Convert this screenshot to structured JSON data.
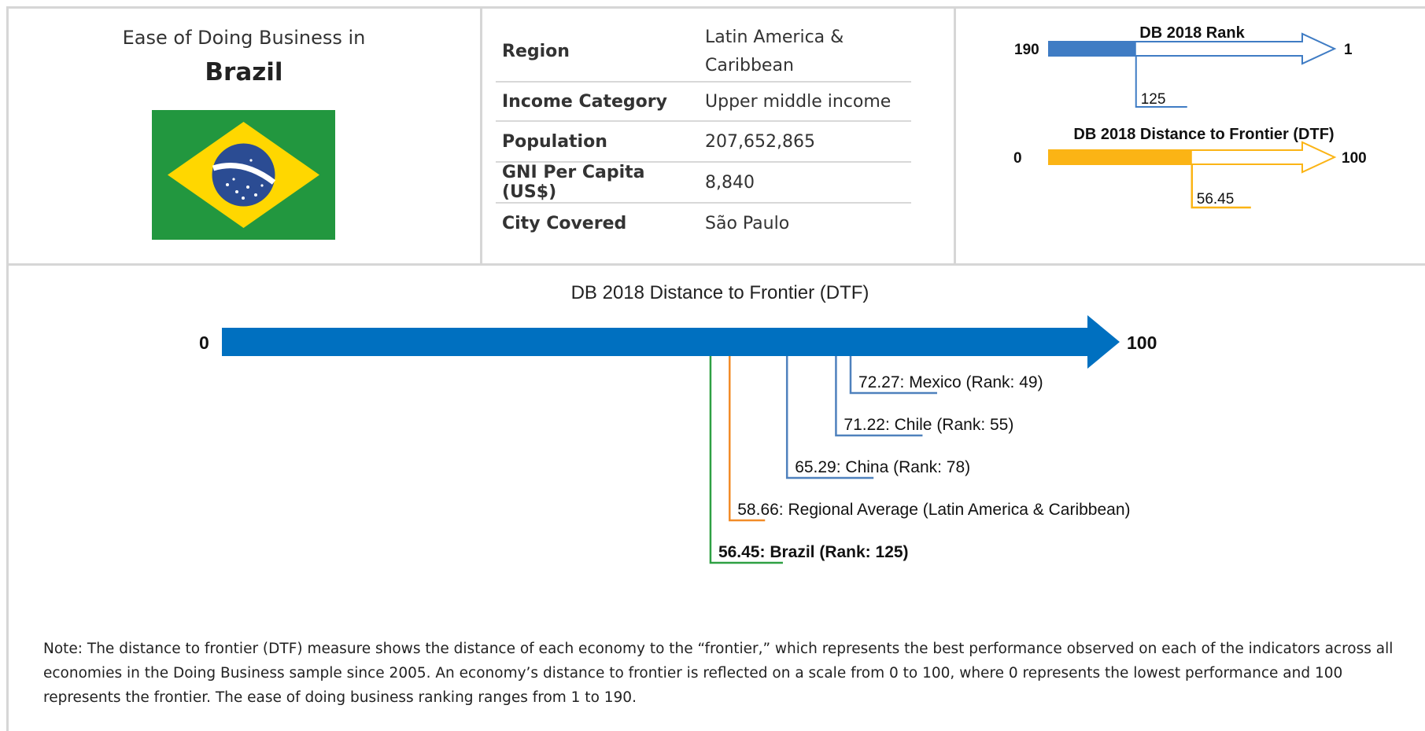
{
  "profile": {
    "title": "Ease of Doing Business in",
    "country": "Brazil",
    "flag_colors": {
      "green": "#22973F",
      "yellow": "#FFD700",
      "blue": "#2B4C93",
      "white": "#ffffff"
    }
  },
  "info": {
    "rows": [
      {
        "label": "Region",
        "value": "Latin America &",
        "value2": "Caribbean"
      },
      {
        "label": "Income Category",
        "value": "Upper middle income"
      },
      {
        "label": "Population",
        "value": "207,652,865"
      },
      {
        "label": "GNI Per Capita (US$)",
        "value": "8,840"
      },
      {
        "label": "City Covered",
        "value": "São Paulo"
      }
    ]
  },
  "chart_data": [
    {
      "type": "bar",
      "title": "DB 2018 Rank",
      "min_label": "190",
      "max_label": "1",
      "range": [
        190,
        1
      ],
      "value": 125,
      "value_label": "125",
      "color": "#3F7CC4"
    },
    {
      "type": "bar",
      "title": "DB 2018 Distance to Frontier (DTF)",
      "min_label": "0",
      "max_label": "100",
      "range": [
        0,
        100
      ],
      "value": 56.45,
      "value_label": "56.45",
      "color": "#FBB415"
    },
    {
      "type": "scatter",
      "title": "DB 2018 Distance to Frontier (DTF)",
      "min_label": "0",
      "max_label": "100",
      "range": [
        0,
        100
      ],
      "arrow_color": "#0070C0",
      "points": [
        {
          "value": 72.27,
          "label": "72.27: Mexico (Rank: 49)",
          "color": "#4F81BD",
          "bold": false
        },
        {
          "value": 71.22,
          "label": "71.22: Chile (Rank: 55)",
          "color": "#4F81BD",
          "bold": false
        },
        {
          "value": 65.29,
          "label": "65.29: China (Rank: 78)",
          "color": "#4F81BD",
          "bold": false
        },
        {
          "value": 58.66,
          "label": "58.66: Regional Average (Latin America & Caribbean)",
          "color": "#F28C28",
          "bold": false
        },
        {
          "value": 56.45,
          "label": "56.45: Brazil (Rank: 125)",
          "color": "#2EA043",
          "bold": true
        }
      ]
    }
  ],
  "note": "Note: The distance to frontier (DTF) measure shows the distance of each economy to the “frontier,” which represents the best performance observed on each of the indicators across all economies in the Doing Business sample since 2005. An economy’s distance to frontier is reflected on a scale from 0 to 100, where 0 represents the lowest performance and 100 represents the frontier. The ease of doing business ranking ranges from 1 to 190."
}
